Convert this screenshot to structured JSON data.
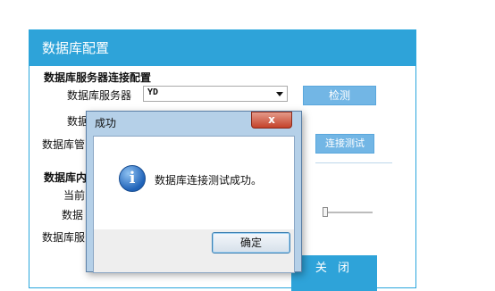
{
  "panel": {
    "title": "数据库配置",
    "section_connection": "数据库服务器连接配置",
    "label_server": "数据库服务器",
    "server_value": "YD",
    "detect_button": "检测",
    "label_db_partial": "数据",
    "label_admin_partial": "数据库管",
    "test_connection_button": "连接测试",
    "section_2_partial": "数据库内",
    "label_current_partial": "当前",
    "label_db2_partial": "数据",
    "label_server2_partial": "数据库服",
    "close_button": "关 闭",
    "accent_color": "#2ea3d9"
  },
  "dialog": {
    "title": "成功",
    "close_symbol": "x",
    "icon": "info-icon",
    "message": "数据库连接测试成功。",
    "ok_button": "确定"
  }
}
